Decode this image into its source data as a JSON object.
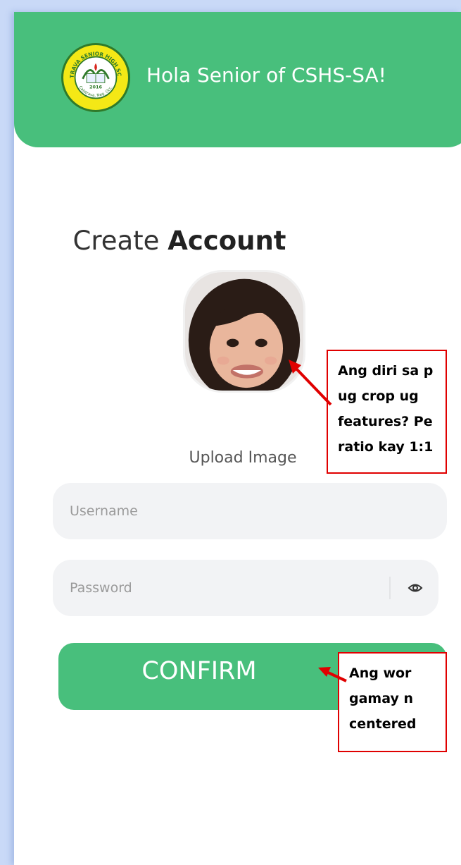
{
  "header": {
    "title": "Hola Senior of CSHS-SA!",
    "logo": {
      "top_text": "CALATRAVA SENIOR HIGH SCHOOL",
      "year": "2016",
      "bottom_text": "Calatrava, Neg. Occ."
    }
  },
  "form": {
    "title_light": "Create",
    "title_bold": "Account",
    "upload_label": "Upload Image",
    "username": {
      "value": "",
      "placeholder": "Username"
    },
    "password": {
      "value": "",
      "placeholder": "Password"
    },
    "confirm_label": "CONFIRM"
  },
  "annotations": {
    "note1_lines": [
      "Ang diri sa p",
      "ug crop ug",
      "features? Pe",
      "ratio kay 1:1"
    ],
    "note2_lines": [
      "Ang wor",
      "gamay n",
      "centered"
    ]
  },
  "icons": {
    "password_toggle": "eye-icon"
  },
  "colors": {
    "accent": "#48bf7c",
    "field_bg": "#f2f3f5",
    "annotation": "#e00000"
  }
}
